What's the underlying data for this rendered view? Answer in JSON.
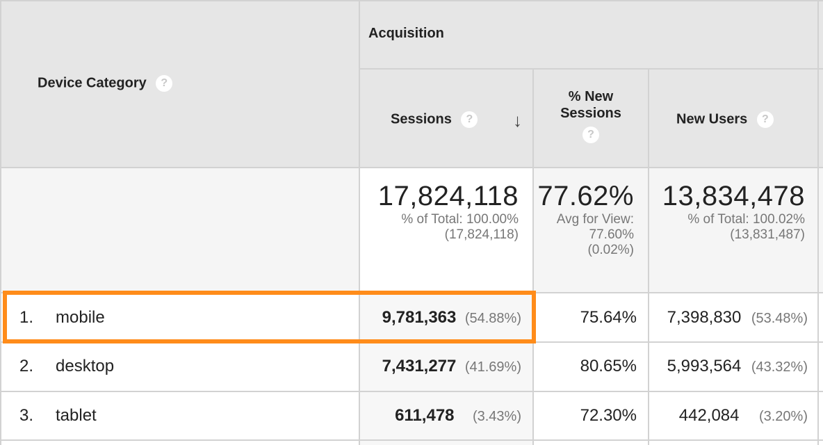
{
  "header": {
    "device_category": "Device Category",
    "acquisition": "Acquisition",
    "sessions": "Sessions",
    "pct_new_sessions_line1": "% New",
    "pct_new_sessions_line2": "Sessions",
    "new_users": "New Users",
    "help_glyph": "?",
    "sort_glyph": "↓"
  },
  "summary": {
    "sessions": {
      "value": "17,824,118",
      "line1": "% of Total: 100.00%",
      "line2": "(17,824,118)"
    },
    "pct_new": {
      "value": "77.62%",
      "line1": "Avg for View:",
      "line2": "77.60%",
      "line3": "(0.02%)"
    },
    "new_users": {
      "value": "13,834,478",
      "line1": "% of Total: 100.02%",
      "line2": "(13,831,487)"
    }
  },
  "rows": [
    {
      "rank": "1.",
      "device": "mobile",
      "sessions": "9,781,363",
      "sessions_pct": "(54.88%)",
      "pct_new": "75.64%",
      "new_users": "7,398,830",
      "new_users_pct": "(53.48%)"
    },
    {
      "rank": "2.",
      "device": "desktop",
      "sessions": "7,431,277",
      "sessions_pct": "(41.69%)",
      "pct_new": "80.65%",
      "new_users": "5,993,564",
      "new_users_pct": "(43.32%)"
    },
    {
      "rank": "3.",
      "device": "tablet",
      "sessions": "611,478",
      "sessions_pct": "(3.43%)",
      "pct_new": "72.30%",
      "new_users": "442,084",
      "new_users_pct": "(3.20%)"
    }
  ],
  "colors": {
    "highlight": "#ff8c1a",
    "header_bg": "#e6e6e6",
    "summary_bg": "#f5f5f5"
  }
}
